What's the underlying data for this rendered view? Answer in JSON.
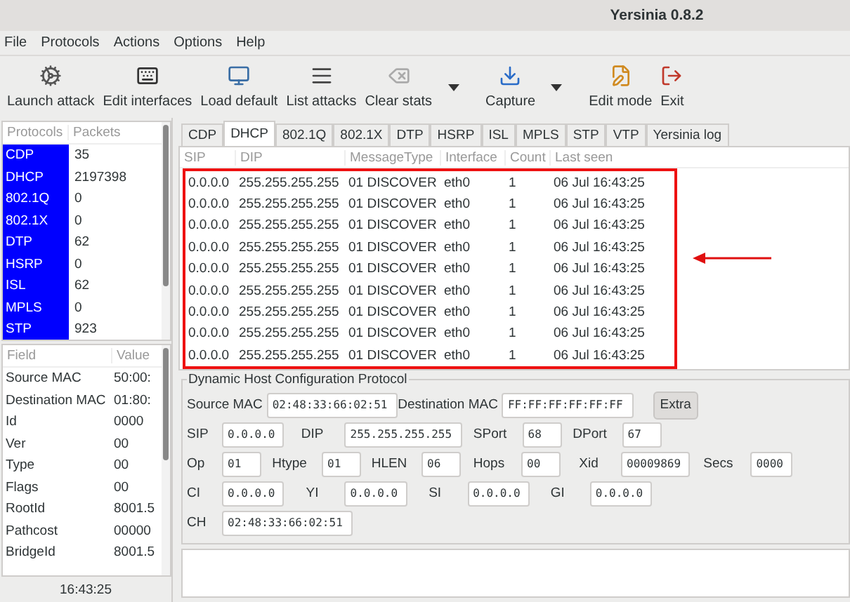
{
  "window": {
    "title": "Yersinia 0.8.2"
  },
  "menu": [
    "File",
    "Protocols",
    "Actions",
    "Options",
    "Help"
  ],
  "toolbar": [
    {
      "label": "Launch attack",
      "dropdown": false
    },
    {
      "label": "Edit interfaces",
      "dropdown": false
    },
    {
      "label": "Load default",
      "dropdown": false
    },
    {
      "label": "List attacks",
      "dropdown": false
    },
    {
      "label": "Clear stats",
      "dropdown": true
    },
    {
      "label": "Capture",
      "dropdown": true
    },
    {
      "label": "Edit mode",
      "dropdown": false
    },
    {
      "label": "Exit",
      "dropdown": false
    }
  ],
  "protocols": {
    "columns": [
      "Protocols",
      "Packets"
    ],
    "rows": [
      {
        "name": "CDP",
        "packets": "35"
      },
      {
        "name": "DHCP",
        "packets": "2197398"
      },
      {
        "name": "802.1Q",
        "packets": "0"
      },
      {
        "name": "802.1X",
        "packets": "0"
      },
      {
        "name": "DTP",
        "packets": "62"
      },
      {
        "name": "HSRP",
        "packets": "0"
      },
      {
        "name": "ISL",
        "packets": "62"
      },
      {
        "name": "MPLS",
        "packets": "0"
      },
      {
        "name": "STP",
        "packets": "923"
      }
    ]
  },
  "fields": {
    "columns": [
      "Field",
      "Value"
    ],
    "rows": [
      {
        "field": "Source MAC",
        "value": "50:00:"
      },
      {
        "field": "Destination MAC",
        "value": "01:80:"
      },
      {
        "field": "Id",
        "value": "0000"
      },
      {
        "field": "Ver",
        "value": "00"
      },
      {
        "field": "Type",
        "value": "00"
      },
      {
        "field": "Flags",
        "value": "00"
      },
      {
        "field": "RootId",
        "value": "8001.5"
      },
      {
        "field": "Pathcost",
        "value": "00000"
      },
      {
        "field": "BridgeId",
        "value": "8001.5"
      }
    ]
  },
  "status_bar": {
    "time": "16:43:25"
  },
  "tabs": [
    {
      "label": "CDP",
      "selected": false
    },
    {
      "label": "DHCP",
      "selected": true
    },
    {
      "label": "802.1Q",
      "selected": false
    },
    {
      "label": "802.1X",
      "selected": false
    },
    {
      "label": "DTP",
      "selected": false
    },
    {
      "label": "HSRP",
      "selected": false
    },
    {
      "label": "ISL",
      "selected": false
    },
    {
      "label": "MPLS",
      "selected": false
    },
    {
      "label": "STP",
      "selected": false
    },
    {
      "label": "VTP",
      "selected": false
    },
    {
      "label": "Yersinia log",
      "selected": false
    }
  ],
  "table": {
    "columns": [
      "SIP",
      "DIP",
      "MessageType",
      "Interface",
      "Count",
      "Last seen"
    ],
    "rows": [
      [
        "0.0.0.0",
        "255.255.255.255",
        "01 DISCOVER",
        "eth0",
        "1",
        "06 Jul 16:43:25"
      ],
      [
        "0.0.0.0",
        "255.255.255.255",
        "01 DISCOVER",
        "eth0",
        "1",
        "06 Jul 16:43:25"
      ],
      [
        "0.0.0.0",
        "255.255.255.255",
        "01 DISCOVER",
        "eth0",
        "1",
        "06 Jul 16:43:25"
      ],
      [
        "0.0.0.0",
        "255.255.255.255",
        "01 DISCOVER",
        "eth0",
        "1",
        "06 Jul 16:43:25"
      ],
      [
        "0.0.0.0",
        "255.255.255.255",
        "01 DISCOVER",
        "eth0",
        "1",
        "06 Jul 16:43:25"
      ],
      [
        "0.0.0.0",
        "255.255.255.255",
        "01 DISCOVER",
        "eth0",
        "1",
        "06 Jul 16:43:25"
      ],
      [
        "0.0.0.0",
        "255.255.255.255",
        "01 DISCOVER",
        "eth0",
        "1",
        "06 Jul 16:43:25"
      ],
      [
        "0.0.0.0",
        "255.255.255.255",
        "01 DISCOVER",
        "eth0",
        "1",
        "06 Jul 16:43:25"
      ],
      [
        "0.0.0.0",
        "255.255.255.255",
        "01 DISCOVER",
        "eth0",
        "1",
        "06 Jul 16:43:25"
      ]
    ]
  },
  "form": {
    "legend": "Dynamic Host Configuration Protocol",
    "lines": [
      [
        {
          "kind": "field",
          "label": "Source MAC",
          "value": "02:48:33:66:02:51"
        },
        {
          "kind": "field",
          "label": "Destination MAC",
          "value": "FF:FF:FF:FF:FF:FF"
        },
        {
          "kind": "button",
          "label": "Extra"
        }
      ],
      [
        {
          "kind": "field",
          "label": "SIP",
          "value": "0.0.0.0"
        },
        {
          "kind": "field",
          "label": "DIP",
          "value": "255.255.255.255"
        },
        {
          "kind": "field",
          "label": "SPort",
          "value": "68"
        },
        {
          "kind": "field",
          "label": "DPort",
          "value": "67"
        }
      ],
      [
        {
          "kind": "field",
          "label": "Op",
          "value": "01"
        },
        {
          "kind": "field",
          "label": "Htype",
          "value": "01"
        },
        {
          "kind": "field",
          "label": "HLEN",
          "value": "06"
        },
        {
          "kind": "field",
          "label": "Hops",
          "value": "00"
        },
        {
          "kind": "field",
          "label": "Xid",
          "value": "00009869"
        },
        {
          "kind": "field",
          "label": "Secs",
          "value": "0000"
        }
      ],
      [
        {
          "kind": "field",
          "label": "CI",
          "value": "0.0.0.0"
        },
        {
          "kind": "field",
          "label": "YI",
          "value": "0.0.0.0"
        },
        {
          "kind": "field",
          "label": "SI",
          "value": "0.0.0.0"
        },
        {
          "kind": "field",
          "label": "GI",
          "value": "0.0.0.0"
        }
      ],
      [
        {
          "kind": "field",
          "label": "CH",
          "value": "02:48:33:66:02:51"
        }
      ]
    ]
  }
}
